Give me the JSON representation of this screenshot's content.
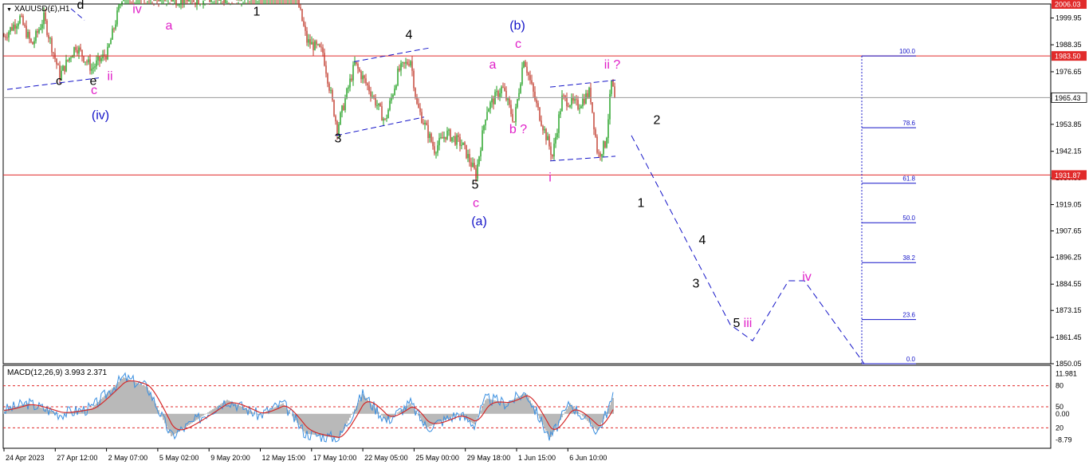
{
  "symbol_label": "XAUUSD(£),H1",
  "indicator_label": "MACD(12,26,9) 3.993 2.371",
  "colors": {
    "bull": "#1b9e1b",
    "bear": "#c0392b",
    "hline": "#e12b2b",
    "wave_black": "#000000",
    "wave_magenta": "#e020c8",
    "wave_blue": "#1414c8",
    "projection": "#1414c8",
    "fib": "#1414c8",
    "macd_hist": "#b9b9b9",
    "macd_main": "#3a8fe0",
    "macd_signal": "#d42a2a"
  },
  "chart_data": {
    "type": "candlestick",
    "timeframe": "H1",
    "y_range": [
      1850.05,
      2006.03
    ],
    "y_ticks": [
      "1999.95",
      "1988.35",
      "1976.65",
      "1965.05",
      "1953.85",
      "1942.15",
      "1930.55",
      "1919.05",
      "1907.65",
      "1896.25",
      "1884.55",
      "1873.15",
      "1861.45",
      "1850.05"
    ],
    "x_labels": [
      "24 Apr 2023",
      "27 Apr 12:00",
      "2 May 07:00",
      "5 May 02:00",
      "9 May 20:00",
      "12 May 15:00",
      "17 May 10:00",
      "22 May 05:00",
      "25 May 00:00",
      "29 May 18:00",
      "1 Jun 15:00",
      "6 Jun 10:00"
    ],
    "price_tags": [
      {
        "value": 2006.03,
        "label": "2006.03",
        "kind": "level"
      },
      {
        "value": 1983.5,
        "label": "1983.50",
        "kind": "level"
      },
      {
        "value": 1965.43,
        "label": "1965.43",
        "kind": "last"
      },
      {
        "value": 1931.87,
        "label": "1931.87",
        "kind": "level"
      }
    ],
    "horizontal_levels": [
      1983.5,
      1931.87
    ],
    "price_anchors": [
      {
        "t": 0,
        "p": 1992
      },
      {
        "t": 20,
        "p": 2000
      },
      {
        "t": 35,
        "p": 1988
      },
      {
        "t": 50,
        "p": 2000
      },
      {
        "t": 70,
        "p": 1975
      },
      {
        "t": 90,
        "p": 1988
      },
      {
        "t": 110,
        "p": 1978
      },
      {
        "t": 130,
        "p": 1985
      },
      {
        "t": 150,
        "p": 2012
      },
      {
        "t": 175,
        "p": 2010
      },
      {
        "t": 210,
        "p": 2008
      },
      {
        "t": 260,
        "p": 2008
      },
      {
        "t": 300,
        "p": 2010
      },
      {
        "t": 325,
        "p": 2012
      },
      {
        "t": 365,
        "p": 2012
      },
      {
        "t": 380,
        "p": 1990
      },
      {
        "t": 400,
        "p": 1985
      },
      {
        "t": 418,
        "p": 1952
      },
      {
        "t": 440,
        "p": 1980
      },
      {
        "t": 460,
        "p": 1968
      },
      {
        "t": 478,
        "p": 1955
      },
      {
        "t": 495,
        "p": 1977
      },
      {
        "t": 510,
        "p": 1982
      },
      {
        "t": 518,
        "p": 1962
      },
      {
        "t": 540,
        "p": 1943
      },
      {
        "t": 555,
        "p": 1950
      },
      {
        "t": 575,
        "p": 1945
      },
      {
        "t": 592,
        "p": 1932
      },
      {
        "t": 605,
        "p": 1960
      },
      {
        "t": 625,
        "p": 1970
      },
      {
        "t": 640,
        "p": 1955
      },
      {
        "t": 652,
        "p": 1983
      },
      {
        "t": 668,
        "p": 1962
      },
      {
        "t": 688,
        "p": 1940
      },
      {
        "t": 700,
        "p": 1965
      },
      {
        "t": 720,
        "p": 1962
      },
      {
        "t": 735,
        "p": 1968
      },
      {
        "t": 745,
        "p": 1940
      },
      {
        "t": 755,
        "p": 1946
      },
      {
        "t": 762,
        "p": 1972
      },
      {
        "t": 766,
        "p": 1965.43
      }
    ],
    "wave_labels": [
      {
        "text": "d",
        "t": 97,
        "p": 2004,
        "color": "black"
      },
      {
        "text": "iv",
        "t": 168,
        "p": 2002,
        "color": "magenta"
      },
      {
        "text": "a",
        "t": 208,
        "p": 1995,
        "color": "magenta"
      },
      {
        "text": "1",
        "t": 318,
        "p": 2001,
        "color": "black"
      },
      {
        "text": "c",
        "t": 70,
        "p": 1971,
        "color": "black"
      },
      {
        "text": "e",
        "t": 113,
        "p": 1971,
        "color": "black"
      },
      {
        "text": "ii",
        "t": 134,
        "p": 1973,
        "color": "magenta"
      },
      {
        "text": "c",
        "t": 114,
        "p": 1967,
        "color": "magenta"
      },
      {
        "text": "(iv)",
        "t": 122,
        "p": 1956,
        "color": "blue"
      },
      {
        "text": "4",
        "t": 509,
        "p": 1991,
        "color": "black"
      },
      {
        "text": "3",
        "t": 420,
        "p": 1946,
        "color": "black"
      },
      {
        "text": "(b)",
        "t": 645,
        "p": 1995,
        "color": "blue"
      },
      {
        "text": "c",
        "t": 646,
        "p": 1987,
        "color": "magenta"
      },
      {
        "text": "a",
        "t": 614,
        "p": 1978,
        "color": "magenta"
      },
      {
        "text": "b ?",
        "t": 646,
        "p": 1950,
        "color": "magenta"
      },
      {
        "text": "ii ?",
        "t": 764,
        "p": 1978,
        "color": "magenta"
      },
      {
        "text": "i",
        "t": 686,
        "p": 1929,
        "color": "magenta"
      },
      {
        "text": "5",
        "t": 592,
        "p": 1926,
        "color": "black"
      },
      {
        "text": "c",
        "t": 593,
        "p": 1918,
        "color": "magenta"
      },
      {
        "text": "(a)",
        "t": 597,
        "p": 1910,
        "color": "blue"
      },
      {
        "text": "2",
        "t": 820,
        "p": 1954,
        "color": "black"
      },
      {
        "text": "1",
        "t": 800,
        "p": 1918,
        "color": "black"
      },
      {
        "text": "4",
        "t": 877,
        "p": 1902,
        "color": "black"
      },
      {
        "text": "3",
        "t": 869,
        "p": 1883,
        "color": "black"
      },
      {
        "text": "5",
        "t": 920,
        "p": 1866,
        "color": "black"
      },
      {
        "text": "iii",
        "t": 934,
        "p": 1866,
        "color": "magenta"
      },
      {
        "text": "iv",
        "t": 1008,
        "p": 1886,
        "color": "magenta"
      }
    ],
    "channel_lines": [
      {
        "from": [
          5,
          1969
        ],
        "to": [
          120,
          1974
        ]
      },
      {
        "from": [
          85,
          2004
        ],
        "to": [
          102,
          1999
        ]
      },
      {
        "from": [
          418,
          1949
        ],
        "to": [
          528,
          1957
        ]
      },
      {
        "from": [
          440,
          1981
        ],
        "to": [
          535,
          1987
        ]
      },
      {
        "from": [
          686,
          1938
        ],
        "to": [
          768,
          1940
        ]
      },
      {
        "from": [
          686,
          1970
        ],
        "to": [
          768,
          1973
        ]
      }
    ],
    "projection_path": [
      [
        788,
        1949
      ],
      [
        912,
        1867
      ],
      [
        940,
        1860
      ],
      [
        985,
        1886
      ],
      [
        1005,
        1886
      ],
      [
        1080,
        1850.05
      ]
    ],
    "fib_levels": [
      {
        "label": "100.0",
        "value": 1983.5
      },
      {
        "label": "78.6",
        "value": 1952.4
      },
      {
        "label": "61.8",
        "value": 1928.3
      },
      {
        "label": "50.0",
        "value": 1911.2
      },
      {
        "label": "38.2",
        "value": 1893.9
      },
      {
        "label": "23.6",
        "value": 1869.2
      },
      {
        "label": "0.0",
        "value": 1850.05
      }
    ],
    "macd": {
      "params": "12,26,9",
      "main": 3.993,
      "signal": 2.371,
      "y_range": [
        -8.79,
        11.981
      ],
      "y_ticks": [
        "11.981",
        "80",
        "50",
        "0.00",
        "20",
        "-8.79"
      ],
      "level_lines": [
        80,
        50,
        20
      ],
      "hist_anchors": [
        {
          "t": 0,
          "v": 45
        },
        {
          "t": 30,
          "v": 55
        },
        {
          "t": 70,
          "v": 40
        },
        {
          "t": 110,
          "v": 48
        },
        {
          "t": 150,
          "v": 92
        },
        {
          "t": 180,
          "v": 78
        },
        {
          "t": 210,
          "v": 8
        },
        {
          "t": 240,
          "v": 30
        },
        {
          "t": 280,
          "v": 60
        },
        {
          "t": 320,
          "v": 38
        },
        {
          "t": 350,
          "v": 55
        },
        {
          "t": 378,
          "v": 12
        },
        {
          "t": 420,
          "v": 5
        },
        {
          "t": 450,
          "v": 68
        },
        {
          "t": 480,
          "v": 30
        },
        {
          "t": 510,
          "v": 55
        },
        {
          "t": 530,
          "v": 20
        },
        {
          "t": 570,
          "v": 40
        },
        {
          "t": 590,
          "v": 25
        },
        {
          "t": 605,
          "v": 62
        },
        {
          "t": 630,
          "v": 55
        },
        {
          "t": 655,
          "v": 70
        },
        {
          "t": 685,
          "v": 5
        },
        {
          "t": 710,
          "v": 55
        },
        {
          "t": 745,
          "v": 15
        },
        {
          "t": 765,
          "v": 65
        }
      ]
    }
  }
}
